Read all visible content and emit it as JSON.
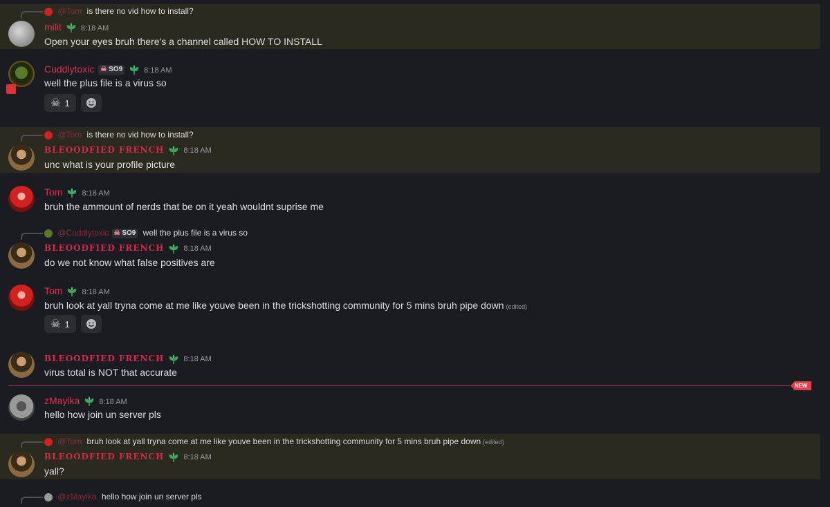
{
  "messages": [
    {
      "reply_name": "@Tom",
      "reply_text": "is there no vid how to install?",
      "author": "milit",
      "time": "8:18 AM",
      "text": "Open your eyes bruh there's a channel called HOW TO INSTALL"
    },
    {
      "author": "Cuddlytoxic",
      "tag": "SO9",
      "time": "8:18 AM",
      "text": "well the plus file is a virus so",
      "reaction_count": "1"
    },
    {
      "reply_name": "@Tom",
      "reply_text": "is there no vid how to install?",
      "author": "BLEOODFIED FRENCH",
      "time": "8:18 AM",
      "text": "unc what is your profile picture"
    },
    {
      "author": "Tom",
      "time": "8:18 AM",
      "text": "bruh the ammount of nerds that be on it yeah wouldnt suprise me"
    },
    {
      "reply_name": "@Cuddlytoxic",
      "reply_tag": "SO9",
      "reply_text": "well the plus file is a virus so",
      "author": "BLEOODFIED FRENCH",
      "time": "8:18 AM",
      "text": "do we not know what false positives are"
    },
    {
      "author": "Tom",
      "time": "8:18 AM",
      "text": "bruh look at yall tryna come at me like youve been in the trickshotting community for 5 mins bruh pipe down",
      "edited": "(edited)",
      "reaction_count": "1"
    },
    {
      "author": "BLEOODFIED FRENCH",
      "time": "8:18 AM",
      "text": "virus total is NOT that accurate"
    },
    {
      "author": "zMayika",
      "time": "8:18 AM",
      "text": "hello how join un server pls"
    },
    {
      "reply_name": "@Tom",
      "reply_text": "bruh look at yall tryna come at me like youve been in the trickshotting community for 5 mins bruh pipe down",
      "reply_edited": "(edited)",
      "author": "BLEOODFIED FRENCH",
      "time": "8:18 AM",
      "text": "yall?"
    },
    {
      "reply_name": "@zMayika",
      "reply_text": "hello how join un server pls"
    }
  ],
  "new_label": "NEW",
  "colors": {
    "background": "#1b1c21",
    "highlight": "#2b2a1f",
    "name": "#e02d52",
    "divider": "#a5323c"
  }
}
